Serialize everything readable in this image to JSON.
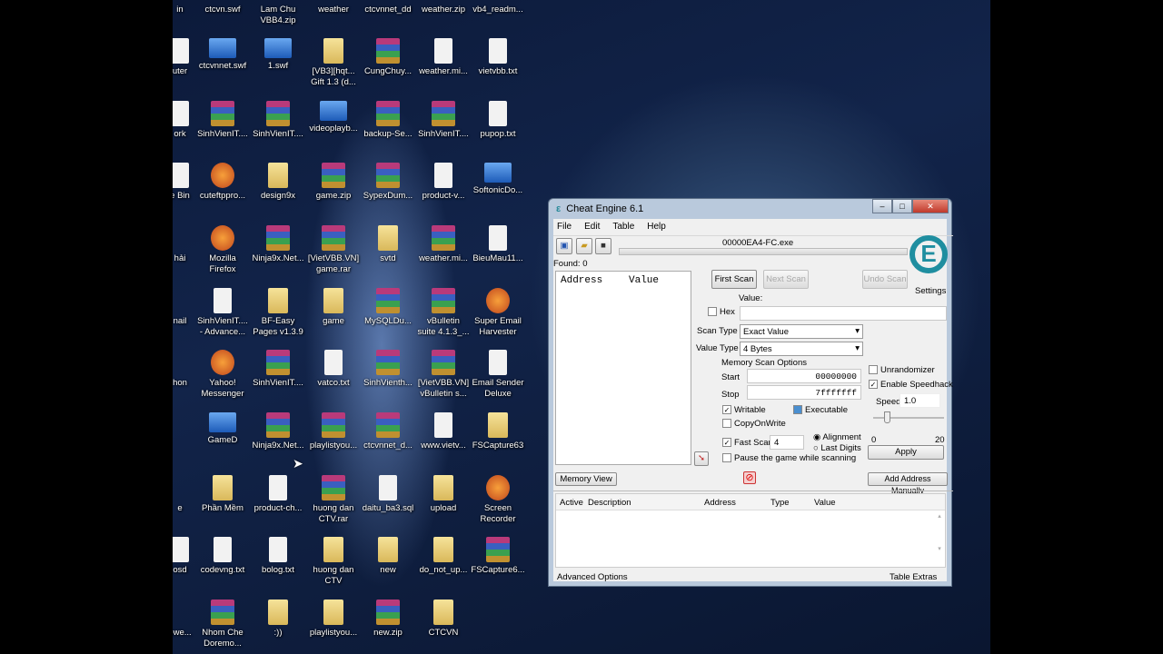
{
  "desktop": {
    "rows": [
      [
        [
          "in",
          "none"
        ],
        [
          "ctcvn.swf",
          "none"
        ],
        [
          "Lam Chu\nVBB4.zip",
          "none"
        ],
        [
          "weather",
          "none"
        ],
        [
          "ctcvnnet_dd",
          "none"
        ],
        [
          "weather.zip",
          "none"
        ],
        [
          "vb4_readm...",
          "none"
        ]
      ],
      [
        [
          "uter",
          "file"
        ],
        [
          "ctcvnnet.swf",
          "swf"
        ],
        [
          "1.swf",
          "swf"
        ],
        [
          "[VB3][hqt...\nGift 1.3 (d...",
          "folder"
        ],
        [
          "CungChuy...",
          "zip"
        ],
        [
          "weather.mi...",
          "file"
        ],
        [
          "vietvbb.txt",
          "file"
        ]
      ],
      [
        [
          "ork",
          "file"
        ],
        [
          "SinhVienIT....",
          "zip"
        ],
        [
          "SinhVienIT....",
          "zip"
        ],
        [
          "videoplayb...",
          "swf"
        ],
        [
          "backup-Se...",
          "zip"
        ],
        [
          "SinhVienIT....",
          "zip"
        ],
        [
          "pupop.txt",
          "file"
        ]
      ],
      [
        [
          "e Bin",
          "file"
        ],
        [
          "cuteftppro...",
          "exe"
        ],
        [
          "design9x",
          "folder"
        ],
        [
          "game.zip",
          "zip"
        ],
        [
          "SypexDum...",
          "zip"
        ],
        [
          "product-v...",
          "file"
        ],
        [
          "SoftonicDo...",
          "swf"
        ]
      ],
      [
        [
          "hải",
          "none"
        ],
        [
          "Mozilla\nFirefox",
          "exe"
        ],
        [
          "Ninja9x.Net...",
          "zip"
        ],
        [
          "[VietVBB.VN]\ngame.rar",
          "zip"
        ],
        [
          "svtd",
          "folder"
        ],
        [
          "weather.mi...",
          "zip"
        ],
        [
          "BieuMau11...",
          "file"
        ]
      ],
      [
        [
          "nail",
          "none"
        ],
        [
          "SinhVienIT....\n- Advance...",
          "file"
        ],
        [
          "BF-Easy\nPages v1.3.9",
          "folder"
        ],
        [
          "game",
          "folder"
        ],
        [
          "MySQLDu...",
          "zip"
        ],
        [
          "vBulletin\nsuite 4.1.3_...",
          "zip"
        ],
        [
          "Super Email\nHarvester",
          "exe"
        ]
      ],
      [
        [
          "hon",
          "none"
        ],
        [
          "Yahoo!\nMessenger",
          "exe"
        ],
        [
          "SinhVienIT....",
          "zip"
        ],
        [
          "vatco.txt",
          "file"
        ],
        [
          "SinhVienth...",
          "zip"
        ],
        [
          "[VietVBB.VN]\nvBulletin s...",
          "zip"
        ],
        [
          "Email Sender\nDeluxe",
          "file"
        ]
      ],
      [
        [
          "",
          "none"
        ],
        [
          "GameD",
          "swf"
        ],
        [
          "Ninja9x.Net...",
          "zip"
        ],
        [
          "playlistyou...",
          "zip"
        ],
        [
          "ctcvnnet_d...",
          "zip"
        ],
        [
          "www.vietv...",
          "file"
        ],
        [
          "FSCapture63",
          "folder"
        ]
      ],
      [
        [
          "e",
          "none"
        ],
        [
          "Phần Mềm",
          "folder"
        ],
        [
          "product-ch...",
          "file"
        ],
        [
          "huong dan\nCTV.rar",
          "zip"
        ],
        [
          "daitu_ba3.sql",
          "file"
        ],
        [
          "upload",
          "folder"
        ],
        [
          "Screen\nRecorder",
          "exe"
        ]
      ],
      [
        [
          "osd",
          "file"
        ],
        [
          "codevng.txt",
          "file"
        ],
        [
          "bolog.txt",
          "file"
        ],
        [
          "huong dan\nCTV",
          "folder"
        ],
        [
          "new",
          "folder"
        ],
        [
          "do_not_up...",
          "folder"
        ],
        [
          "FSCapture6...",
          "zip"
        ]
      ],
      [
        [
          "ewe...",
          "none"
        ],
        [
          "Nhom Che\nDoremo...",
          "zip"
        ],
        [
          ":))",
          "folder"
        ],
        [
          "playlistyou...",
          "folder"
        ],
        [
          "new.zip",
          "zip"
        ],
        [
          "CTCVN",
          "folder"
        ],
        [
          "",
          "none"
        ]
      ]
    ]
  },
  "ce": {
    "title": "Cheat Engine 6.1",
    "menu": [
      "File",
      "Edit",
      "Table",
      "Help"
    ],
    "process": "00000EA4-FC.exe",
    "found": "Found: 0",
    "list_headers": [
      "Address",
      "Value"
    ],
    "first_scan": "First Scan",
    "next_scan": "Next Scan",
    "undo_scan": "Undo Scan",
    "settings": "Settings",
    "value_label": "Value:",
    "hex": "Hex",
    "scan_type_label": "Scan Type",
    "scan_type": "Exact Value",
    "value_type_label": "Value Type",
    "value_type": "4 Bytes",
    "mem_opts": "Memory Scan Options",
    "start_label": "Start",
    "start": "00000000",
    "stop_label": "Stop",
    "stop": "7fffffff",
    "writable": "Writable",
    "executable": "Executable",
    "copyonwrite": "CopyOnWrite",
    "fast_scan": "Fast Scan",
    "fast_scan_value": "4",
    "alignment": "Alignment",
    "last_digits": "Last Digits",
    "pause": "Pause the game while scanning",
    "unrandomizer": "Unrandomizer",
    "speedhack": "Enable Speedhack",
    "speed_label": "Speed",
    "speed": "1.0",
    "slider_min": "0",
    "slider_max": "20",
    "slider_value": 1,
    "apply": "Apply",
    "memory_view": "Memory View",
    "add_address": "Add Address Manually",
    "table_headers": [
      "Active",
      "Description",
      "Address",
      "Type",
      "Value"
    ],
    "advanced": "Advanced Options",
    "table_extras": "Table Extras"
  }
}
